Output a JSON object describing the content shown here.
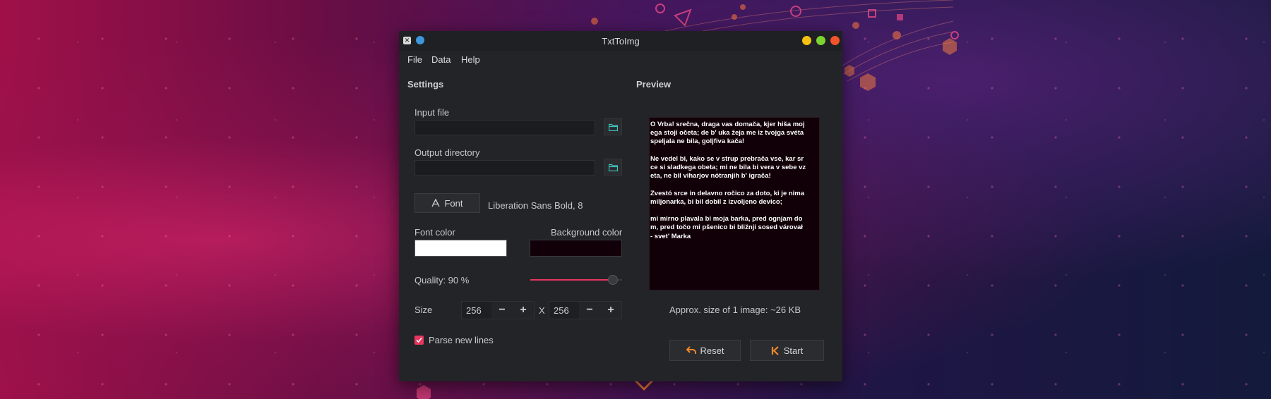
{
  "window": {
    "title": "TxtToImg",
    "titlebar_buttons": [
      {
        "name": "minimize",
        "color": "#f5c211"
      },
      {
        "name": "maximize",
        "color": "#7cd32f"
      },
      {
        "name": "close",
        "color": "#f0542a"
      }
    ]
  },
  "menu": [
    "File",
    "Data",
    "Help"
  ],
  "settings": {
    "title": "Settings",
    "input_file": {
      "label": "Input file",
      "value": "",
      "browse_icon": "folder-open-icon"
    },
    "output_directory": {
      "label": "Output directory",
      "value": "",
      "browse_icon": "folder-open-icon"
    },
    "font": {
      "button_label": "Font",
      "button_icon": "font-icon",
      "current": "Liberation Sans Bold, 8"
    },
    "font_color": {
      "label": "Font color",
      "value": "#ffffff"
    },
    "background_color": {
      "label": "Background color",
      "value": "#110007"
    },
    "quality": {
      "label": "Quality: 90 %",
      "value": 90
    },
    "size": {
      "label": "Size",
      "width": "256",
      "height": "256",
      "separator": "X",
      "minus": "−",
      "plus": "+"
    },
    "parse_new_lines": {
      "label": "Parse new lines",
      "checked": true
    }
  },
  "preview": {
    "title": "Preview",
    "text": "O Vrba! srečna, draga vas domača, kjer hiša moj\nega stoji očeta; de b' uka žeja me iz tvojga svéta\nspeljala ne bila, goljfiva kača!\n\nNe vedel bi, kako se v strup prebrača vse, kar sr\nce si sladkega obeta; mi ne bila bi vera v sebe vz\neta, ne bil viharjov nótranjih b' igrača!\n\nZvestó srce in delavno ročico za doto, ki je nima\nmiljonarka, bi bil dobil z izvoljeno devico;\n\nmi mirno plavala bi moja barka, pred ognjam do\nm, pred točo mi pšenico bi bližnji sosed várovał\n- svet' Marka",
    "size_info": "Approx. size of 1 image: ~26 KB"
  },
  "actions": {
    "reset": {
      "label": "Reset",
      "icon": "undo-arrow-icon"
    },
    "start": {
      "label": "Start",
      "icon": "start-icon"
    }
  },
  "colors": {
    "accent": "#e8365f",
    "window_bg": "#232428",
    "field_bg": "#1b1c1f"
  }
}
